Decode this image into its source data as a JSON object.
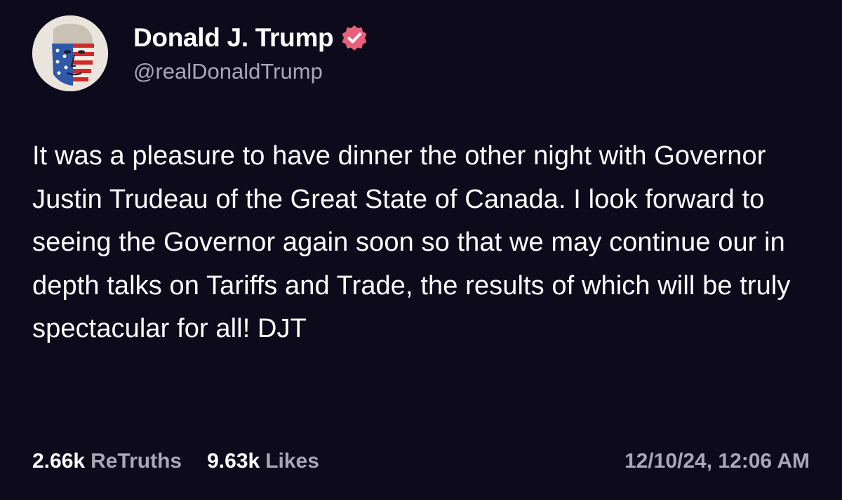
{
  "post": {
    "author": {
      "display_name": "Donald J. Trump",
      "handle": "@realDonaldTrump",
      "verified_icon": "verified-badge-icon",
      "avatar_icon": "flag-portrait-avatar"
    },
    "body": "It was a pleasure to have dinner the other night with Governor Justin Trudeau of the Great State of Canada. I look forward to seeing the Governor again soon so that we may continue our in depth talks on Tariffs and Trade, the results of which will be truly spectacular for all! DJT",
    "stats": {
      "retruths_count": "2.66k",
      "retruths_label": "ReTruths",
      "likes_count": "9.63k",
      "likes_label": "Likes"
    },
    "timestamp": "12/10/24, 12:06 AM"
  },
  "colors": {
    "background": "#0d0a1c",
    "text_primary": "#ffffff",
    "text_secondary": "#a9a6b6",
    "verified_badge": "#e8607a"
  }
}
